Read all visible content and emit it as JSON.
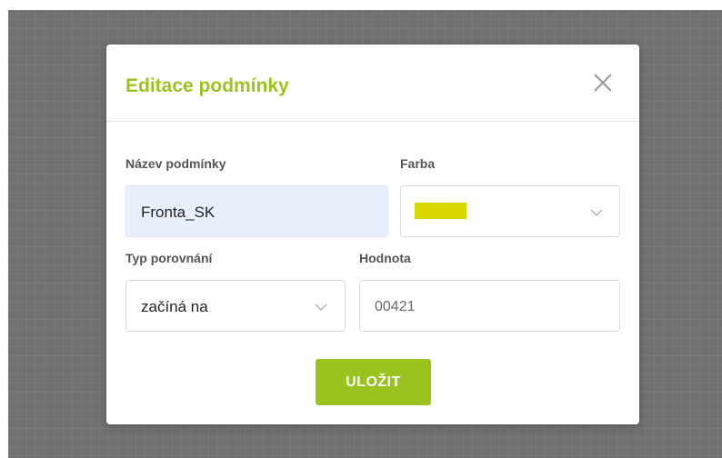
{
  "dialog": {
    "title": "Editace podmínky",
    "close_icon": "close-icon"
  },
  "form": {
    "name": {
      "label": "Název podmínky",
      "value": "Fronta_SK"
    },
    "color": {
      "label": "Farba",
      "selected_color": "#d8d800",
      "icon": "chevron-down-icon"
    },
    "comparison_type": {
      "label": "Typ porovnání",
      "value": "začíná na",
      "icon": "chevron-down-icon"
    },
    "value": {
      "label": "Hodnota",
      "value": "00421"
    }
  },
  "actions": {
    "save_label": "ULOŽIT"
  },
  "theme": {
    "accent": "#9bc31f",
    "backdrop": "#717171"
  }
}
